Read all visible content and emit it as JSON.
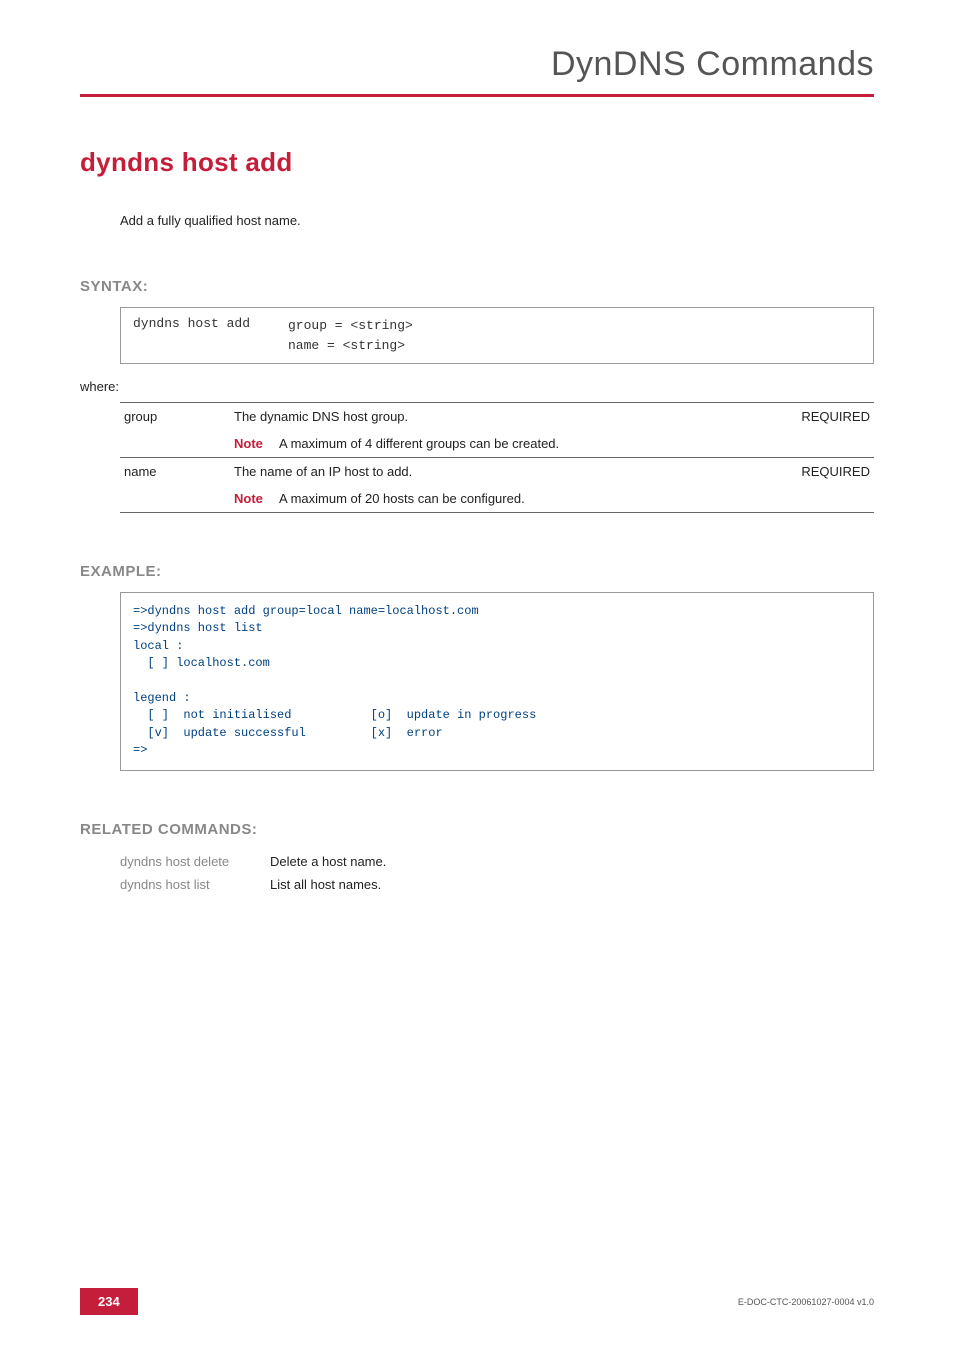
{
  "header": {
    "title": "DynDNS Commands"
  },
  "command": {
    "title": "dyndns host add",
    "description": "Add a fully qualified host name."
  },
  "syntax": {
    "heading": "SYNTAX:",
    "cmd": "dyndns host add",
    "args": "group = <string>\nname = <string>",
    "where": "where:"
  },
  "params": [
    {
      "name": "group",
      "desc": "The dynamic DNS host group.",
      "note": "A maximum of 4 different groups can be created.",
      "required": "REQUIRED"
    },
    {
      "name": "name",
      "desc": "The name of an IP host to add.",
      "note": "A maximum of 20 hosts can be configured.",
      "required": "REQUIRED"
    }
  ],
  "noteLabel": "Note",
  "example": {
    "heading": "EXAMPLE:",
    "text": "=>dyndns host add group=local name=localhost.com\n=>dyndns host list\nlocal :\n  [ ] localhost.com\n\nlegend :\n  [ ]  not initialised           [o]  update in progress\n  [v]  update successful         [x]  error\n=>"
  },
  "related": {
    "heading": "RELATED COMMANDS:",
    "items": [
      {
        "cmd": "dyndns host delete",
        "desc": "Delete a host name."
      },
      {
        "cmd": "dyndns host list",
        "desc": "List all host names."
      }
    ]
  },
  "footer": {
    "page": "234",
    "docid": "E-DOC-CTC-20061027-0004 v1.0"
  }
}
